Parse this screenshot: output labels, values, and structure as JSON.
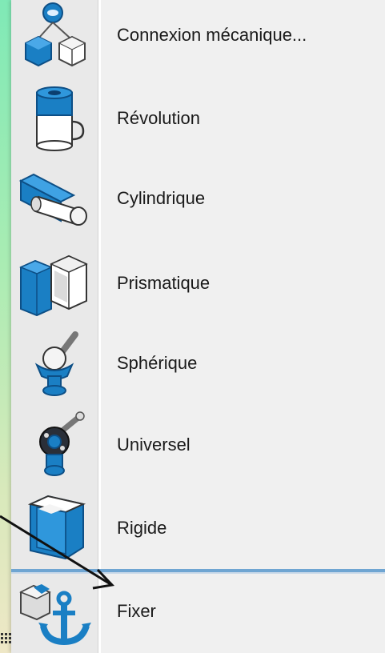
{
  "menu": {
    "items": [
      {
        "label": "Connexion mécanique...",
        "icon": "mechanical-connection-icon"
      },
      {
        "label": "Révolution",
        "icon": "revolute-joint-icon"
      },
      {
        "label": "Cylindrique",
        "icon": "cylindrical-joint-icon"
      },
      {
        "label": "Prismatique",
        "icon": "prismatic-joint-icon"
      },
      {
        "label": "Sphérique",
        "icon": "spherical-joint-icon"
      },
      {
        "label": "Universel",
        "icon": "universal-joint-icon"
      },
      {
        "label": "Rigide",
        "icon": "rigid-joint-icon"
      },
      {
        "label": "Fixer",
        "icon": "fix-anchor-icon"
      }
    ]
  },
  "colors": {
    "icon_blue": "#1a7fc4",
    "icon_dark": "#0d4f86",
    "separator_blue": "#6fa5d2",
    "menu_bg": "#f0f0f0"
  }
}
